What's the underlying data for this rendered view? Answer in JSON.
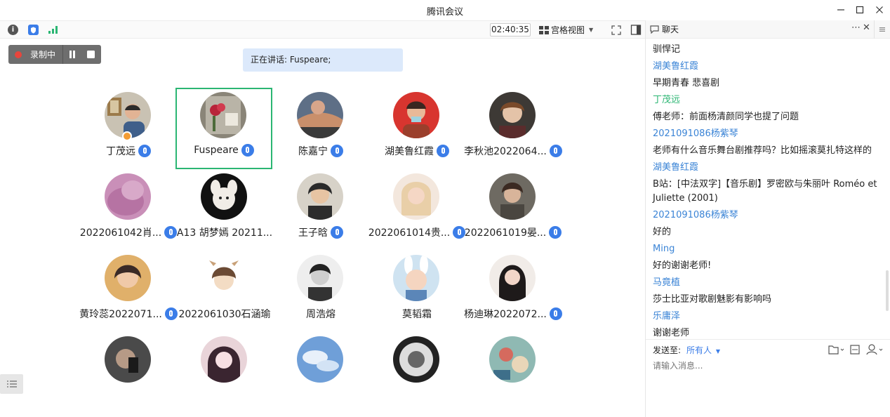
{
  "window": {
    "title": "腾讯会议",
    "controls": [
      "minimize",
      "maximize",
      "close"
    ]
  },
  "toolbar": {
    "left_icons": [
      "info-icon",
      "shield-icon",
      "signal-icon"
    ],
    "timer": "02:40:35",
    "view_mode": "宫格视图",
    "right_icons": [
      "fullscreen-icon",
      "sidebar-toggle-icon"
    ]
  },
  "recording": {
    "label": "录制中"
  },
  "speaker": {
    "text": "正在讲话: Fuspeare;"
  },
  "participants": [
    {
      "name": "丁茂远",
      "mic": true,
      "host": true
    },
    {
      "name": "Fuspeare",
      "mic": true,
      "active": true
    },
    {
      "name": "陈嘉宁",
      "mic": true
    },
    {
      "name": "湖美鲁红霞",
      "mic": true
    },
    {
      "name": "李秋池2022064...",
      "mic": true
    },
    {
      "name": "2022061042肖...",
      "mic": true
    },
    {
      "name": "A13 胡梦嫣 20211...",
      "mic": false
    },
    {
      "name": "王子晗",
      "mic": true
    },
    {
      "name": "2022061014贵...",
      "mic": true
    },
    {
      "name": "2022061019晏...",
      "mic": true
    },
    {
      "name": "黄玲蕊2022071...",
      "mic": true
    },
    {
      "name": "2022061030石涵瑜",
      "mic": false
    },
    {
      "name": "周浩熔",
      "mic": false
    },
    {
      "name": "莫韬霜",
      "mic": false
    },
    {
      "name": "杨迪琳2022072...",
      "mic": true
    }
  ],
  "chat": {
    "title": "聊天",
    "messages": [
      {
        "type": "text",
        "text": "驯悍记"
      },
      {
        "type": "name",
        "text": "湖美鲁红霞"
      },
      {
        "type": "text",
        "text": "早期青春 悲喜剧"
      },
      {
        "type": "name",
        "text": "丁茂远",
        "green": true
      },
      {
        "type": "text",
        "text": "傅老师：前面杨清颜同学也提了问题"
      },
      {
        "type": "name",
        "text": "2021091086杨紫琴"
      },
      {
        "type": "text",
        "text": "老师有什么音乐舞台剧推荐吗？比如摇滚莫扎特这样的"
      },
      {
        "type": "name",
        "text": "湖美鲁红霞"
      },
      {
        "type": "wrap",
        "text": "B站：[中法双字]【音乐剧】罗密欧与朱丽叶 Roméo et Juliette (2001)"
      },
      {
        "type": "name",
        "text": "2021091086杨紫琴"
      },
      {
        "type": "text",
        "text": "好的"
      },
      {
        "type": "name",
        "text": "Ming"
      },
      {
        "type": "text",
        "text": "好的谢谢老师!"
      },
      {
        "type": "name",
        "text": "马竟植"
      },
      {
        "type": "text",
        "text": "莎士比亚对歌剧魅影有影响吗"
      },
      {
        "type": "name",
        "text": "乐庸泽"
      },
      {
        "type": "text",
        "text": "谢谢老师"
      }
    ],
    "send_to_label": "发送至:",
    "recipient": "所有人",
    "input_placeholder": "请输入消息..."
  },
  "colors": {
    "accent": "#3b7de8",
    "active_border": "#2bb673",
    "name_link": "#3b84d6",
    "recording": "#e8453c"
  }
}
